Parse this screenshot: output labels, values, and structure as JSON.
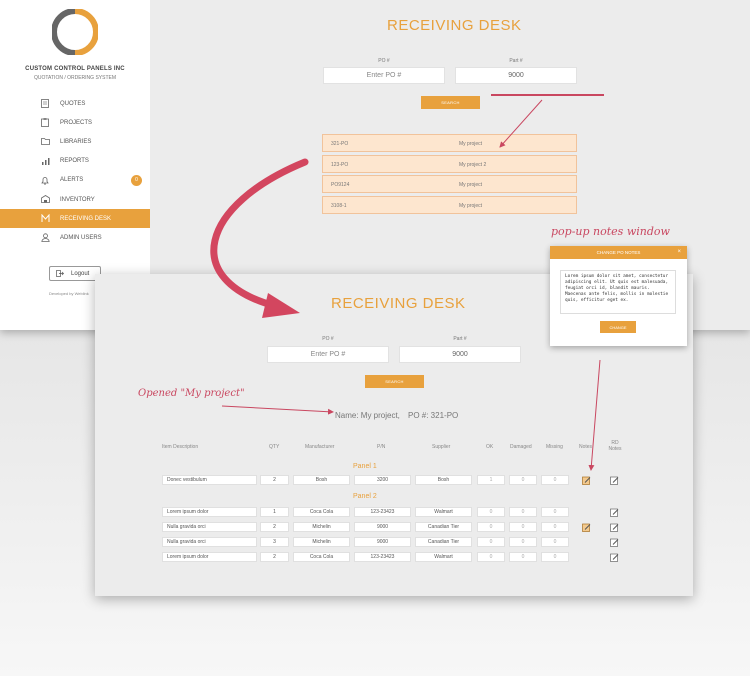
{
  "back": {
    "company_name": "CUSTOM CONTROL PANELS INC",
    "company_sub": "QUOTATION / ORDERING SYSTEM",
    "nav": [
      {
        "label": "QUOTES",
        "icon": "document-icon"
      },
      {
        "label": "PROJECTS",
        "icon": "clipboard-icon"
      },
      {
        "label": "LIBRARIES",
        "icon": "folder-icon"
      },
      {
        "label": "REPORTS",
        "icon": "bar-chart-icon"
      },
      {
        "label": "ALERTS",
        "icon": "bell-icon",
        "badge": "0"
      },
      {
        "label": "INVENTORY",
        "icon": "warehouse-icon"
      },
      {
        "label": "RECEIVING DESK",
        "icon": "receiving-icon",
        "active": true
      },
      {
        "label": "ADMIN USERS",
        "icon": "users-icon"
      }
    ],
    "logout_label": "Logout",
    "developed_by": "Developed by Weblink",
    "title": "RECEIVING DESK",
    "po_label": "PO #",
    "part_label": "Part #",
    "po_placeholder": "Enter PO #",
    "part_value": "9000",
    "search_label": "SEARCH",
    "results": [
      {
        "po": "321-PO",
        "name": "My project"
      },
      {
        "po": "123-PO",
        "name": "My project 2"
      },
      {
        "po": "PO9124",
        "name": "My project"
      },
      {
        "po": "3108-1",
        "name": "My project"
      }
    ]
  },
  "annotations": {
    "popup_label": "pop-up notes window",
    "opened_label": "Opened \"My project\""
  },
  "front": {
    "title": "RECEIVING DESK",
    "po_label": "PO #",
    "part_label": "Part #",
    "po_placeholder": "Enter PO #",
    "part_value": "9000",
    "search_label": "SEARCH",
    "opened": "Name: My project,",
    "opened_po": "PO #: 321-PO",
    "columns": [
      "Item Description",
      "QTY",
      "Manufacturer",
      "P/N",
      "Supplier",
      "OK",
      "Damaged",
      "Missing",
      "Notes",
      "RD Notes"
    ],
    "panels": [
      {
        "name": "Panel 1",
        "rows": [
          {
            "desc": "Donec vestibulum",
            "qty": "2",
            "mfr": "Bosh",
            "pn": "3200",
            "supplier": "Bosh",
            "ok": "1",
            "damaged": "0",
            "missing": "0",
            "has_note": true
          }
        ]
      },
      {
        "name": "Panel 2",
        "rows": [
          {
            "desc": "Lorem ipsum dolor",
            "qty": "1",
            "mfr": "Coca Cola",
            "pn": "123-23423",
            "supplier": "Walmart",
            "ok": "0",
            "damaged": "0",
            "missing": "0",
            "has_note": false
          },
          {
            "desc": "Nulla gravida orci",
            "qty": "2",
            "mfr": "Michelin",
            "pn": "9000",
            "supplier": "Canadian Tier",
            "ok": "0",
            "damaged": "0",
            "missing": "0",
            "has_note": true
          },
          {
            "desc": "Nulla gravida orci",
            "qty": "3",
            "mfr": "Michelin",
            "pn": "9000",
            "supplier": "Canadian Tier",
            "ok": "0",
            "damaged": "0",
            "missing": "0",
            "has_note": false
          },
          {
            "desc": "Lorem ipsum dolor",
            "qty": "2",
            "mfr": "Coca Cola",
            "pn": "123-23423",
            "supplier": "Walmart",
            "ok": "0",
            "damaged": "0",
            "missing": "0",
            "has_note": false
          }
        ]
      }
    ]
  },
  "popup": {
    "title": "CHANGE PO NOTES",
    "close": "×",
    "text": "Lorem ipsum dolor sit amet, consectetur adipiscing elit. Ut quis est malesuada, feugiat orci id, blandit mauris. Maecenas ante felis, mollis in molestie quis, efficitur eget ex.",
    "button": "CHANGE"
  },
  "colors": {
    "accent": "#e8a13d",
    "annotation": "#c94760",
    "result_bg": "#fde6cf"
  }
}
